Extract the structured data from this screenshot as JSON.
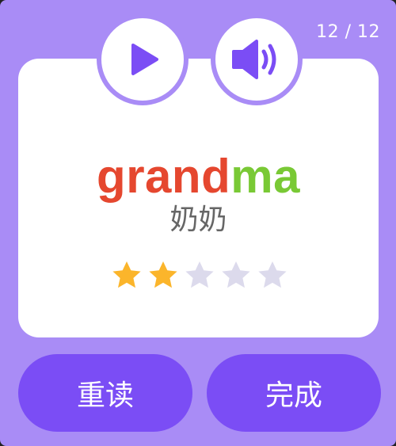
{
  "header": {
    "counter": "12 / 12"
  },
  "card": {
    "word_part1": "grand",
    "word_part2": "ma",
    "translation": "奶奶",
    "rating": {
      "value": 2,
      "max": 5
    }
  },
  "controls": {
    "play_icon": "play-icon",
    "sound_icon": "speaker-icon"
  },
  "actions": {
    "reread_label": "重读",
    "done_label": "完成"
  },
  "colors": {
    "background": "#a98cf6",
    "accent": "#7b4df5",
    "word_part1": "#e5472f",
    "word_part2": "#79c935",
    "star_filled": "#fbb52b",
    "star_empty": "#dcdaec"
  }
}
